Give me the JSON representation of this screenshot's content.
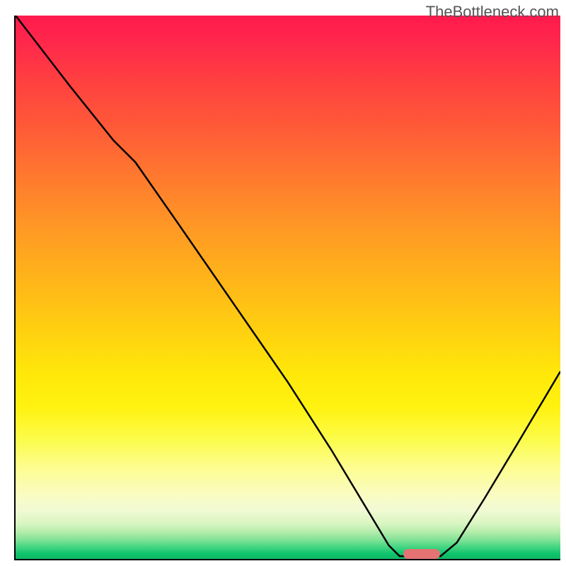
{
  "watermark": "TheBottleneck.com",
  "chart_data": {
    "type": "line",
    "description": "Bottleneck severity curve over a gradient background (red = high bottleneck at top, green = optimal at bottom). The black curve descends from upper-left, reaches near-zero (optimal) around x≈0.74, then rises toward the right edge.",
    "x_range": [
      0,
      1
    ],
    "y_range": [
      0,
      1
    ],
    "curve_points": [
      {
        "x": 0.0,
        "y": 1.0
      },
      {
        "x": 0.1,
        "y": 0.87
      },
      {
        "x": 0.18,
        "y": 0.77
      },
      {
        "x": 0.22,
        "y": 0.73
      },
      {
        "x": 0.3,
        "y": 0.615
      },
      {
        "x": 0.4,
        "y": 0.47
      },
      {
        "x": 0.5,
        "y": 0.325
      },
      {
        "x": 0.58,
        "y": 0.2
      },
      {
        "x": 0.64,
        "y": 0.1
      },
      {
        "x": 0.685,
        "y": 0.025
      },
      {
        "x": 0.705,
        "y": 0.005
      },
      {
        "x": 0.78,
        "y": 0.005
      },
      {
        "x": 0.81,
        "y": 0.03
      },
      {
        "x": 0.86,
        "y": 0.11
      },
      {
        "x": 0.92,
        "y": 0.21
      },
      {
        "x": 1.0,
        "y": 0.345
      }
    ],
    "optimal_marker": {
      "x": 0.745,
      "y": 0.0
    },
    "gradient_colors": {
      "top": "#ff1a4d",
      "mid_upper": "#ff9526",
      "mid": "#ffe80a",
      "mid_lower": "#fcfc4a",
      "bottom": "#0eb866"
    },
    "marker_color": "#e57373",
    "curve_color": "#000000"
  }
}
